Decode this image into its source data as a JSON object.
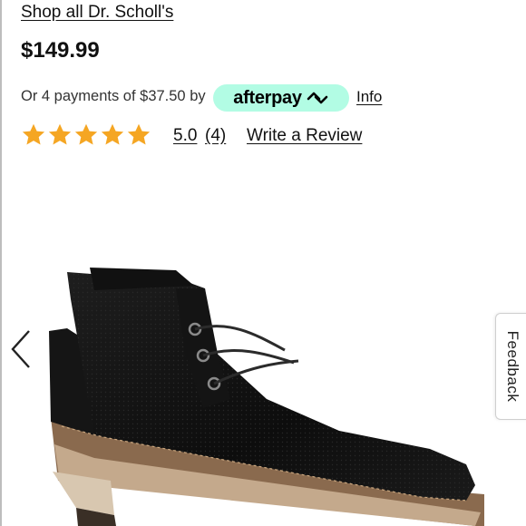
{
  "product": {
    "brand_link": "Shop all Dr. Scholl's",
    "price": "$149.99"
  },
  "payment": {
    "installments_text": "Or 4 payments of $37.50 by",
    "provider_name": "afterpay",
    "info_link": "Info",
    "badge_color": "#b2fce4"
  },
  "rating": {
    "stars": 5,
    "max_stars": 5,
    "value": "5.0",
    "count": "(4)",
    "write_review": "Write a Review",
    "star_color": "#f5a623"
  },
  "gallery": {
    "prev_icon": "chevron-left-icon",
    "image_subject": "shoe"
  },
  "feedback": {
    "label": "Feedback"
  }
}
